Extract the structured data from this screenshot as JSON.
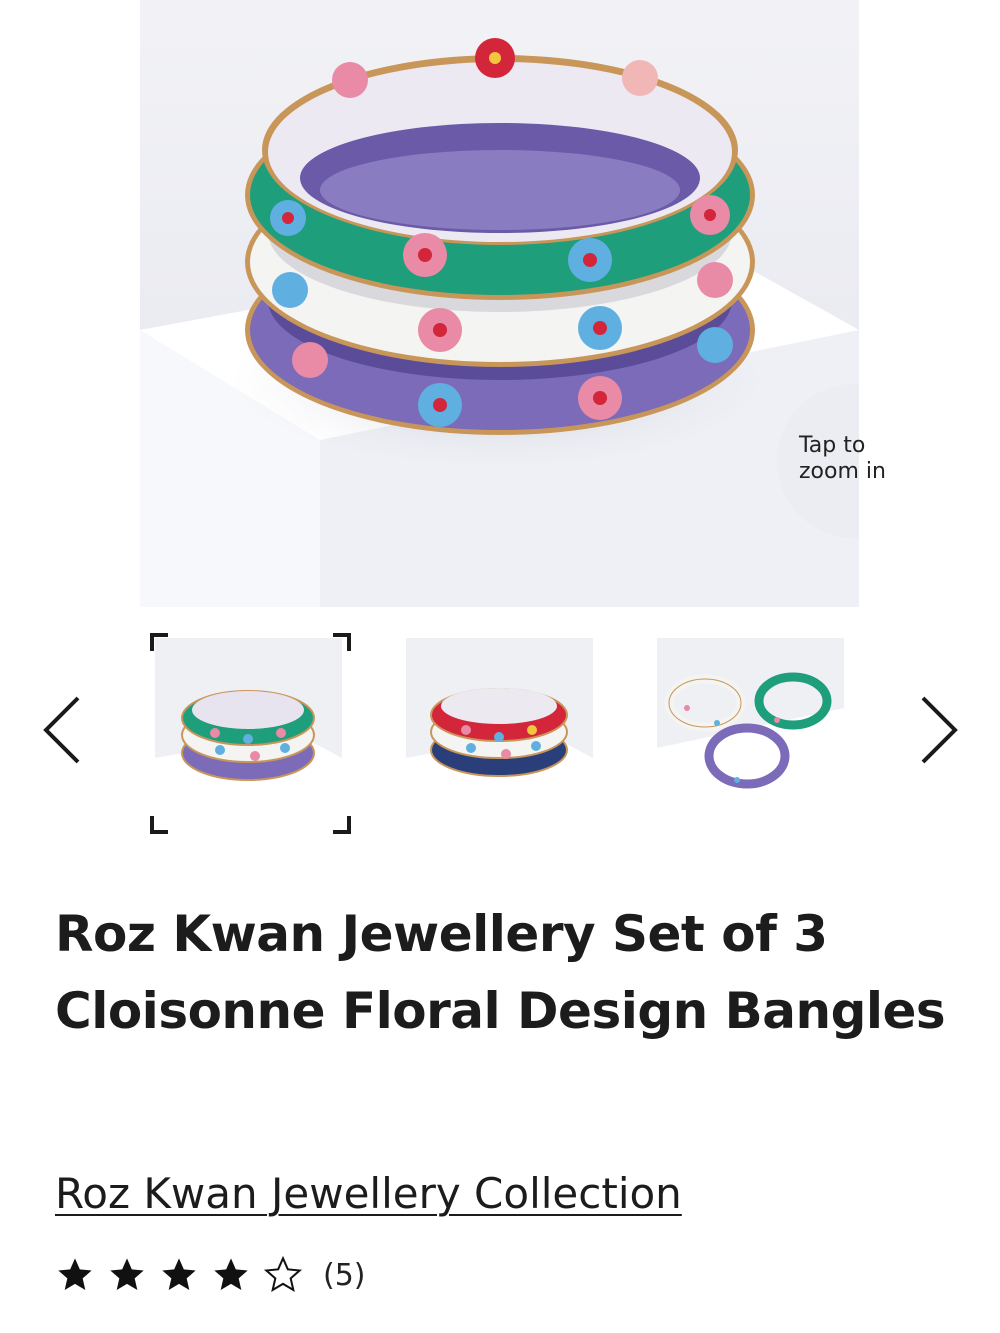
{
  "gallery": {
    "zoom_hint": "Tap to zoom in",
    "prev_icon": "chevron-left-icon",
    "next_icon": "chevron-right-icon",
    "selected_index": 0,
    "thumbnail_count": 3
  },
  "product": {
    "title": "Roz Kwan Jewellery Set of 3 Cloisonne Floral Design Bangles",
    "brand_link": "Roz Kwan Jewellery Collection",
    "rating": {
      "stars_filled": 4,
      "stars_total": 5,
      "count_label": "(5)"
    }
  },
  "colors": {
    "green_enamel": "#1f9e7c",
    "white_enamel": "#f4f4f2",
    "purple_enamel": "#7b6bb8",
    "red_enamel": "#d3263a",
    "navy_enamel": "#2a3f7a",
    "gold_trim": "#c9965a",
    "text": "#1c1c1c"
  }
}
